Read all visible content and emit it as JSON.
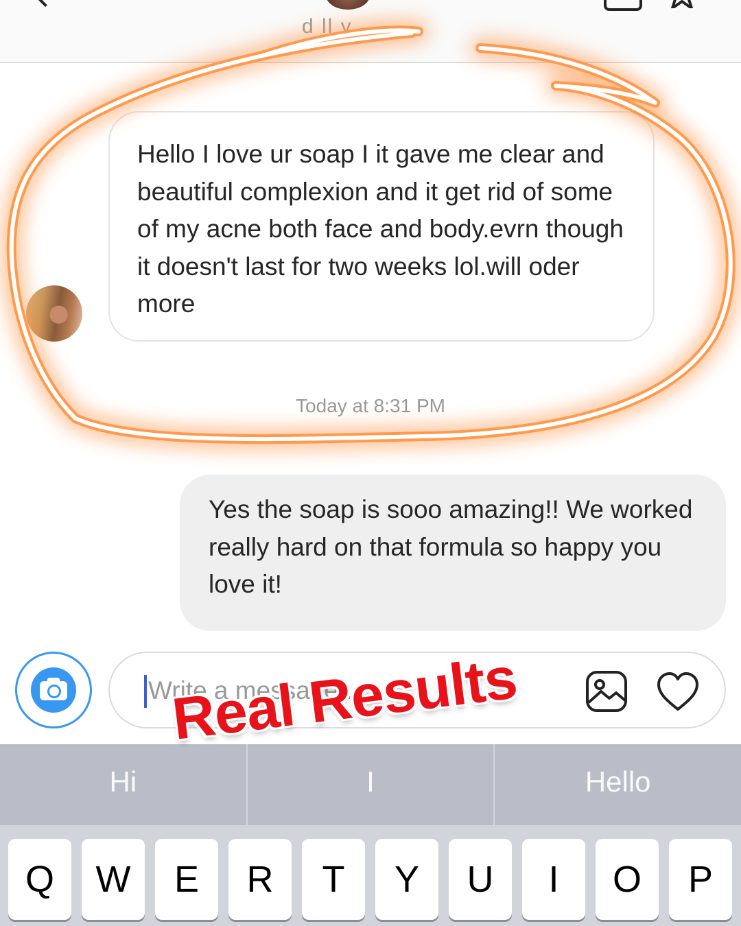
{
  "header": {
    "username_partial": "d  ll  y  "
  },
  "conversation": {
    "incoming_message": "Hello I love ur soap I it gave me clear and beautiful complexion and it get rid of some of my acne both face and body.evrn though it doesn't last for two weeks lol.will oder more",
    "timestamp": "Today at 8:31 PM",
    "outgoing_message": "Yes the soap is sooo amazing!! We worked really hard on that formula so happy you love it!"
  },
  "composer": {
    "placeholder": "Write a message..."
  },
  "keyboard": {
    "suggestions": [
      "Hi",
      "I",
      "Hello"
    ],
    "keys": [
      "Q",
      "W",
      "E",
      "R",
      "T",
      "Y",
      "U",
      "I",
      "O",
      "P"
    ]
  },
  "annotation": {
    "text": "Real Results"
  },
  "colors": {
    "accent": "#3897f0",
    "annotation_red": "#e8121b",
    "highlight_glow": "#ff8c3a",
    "incoming_bubble_border": "#e3e3e3",
    "outgoing_bubble_bg": "#efefef"
  },
  "icons": [
    "back-chevron-icon",
    "video-icon",
    "star-icon",
    "camera-icon",
    "gallery-icon",
    "heart-icon"
  ]
}
